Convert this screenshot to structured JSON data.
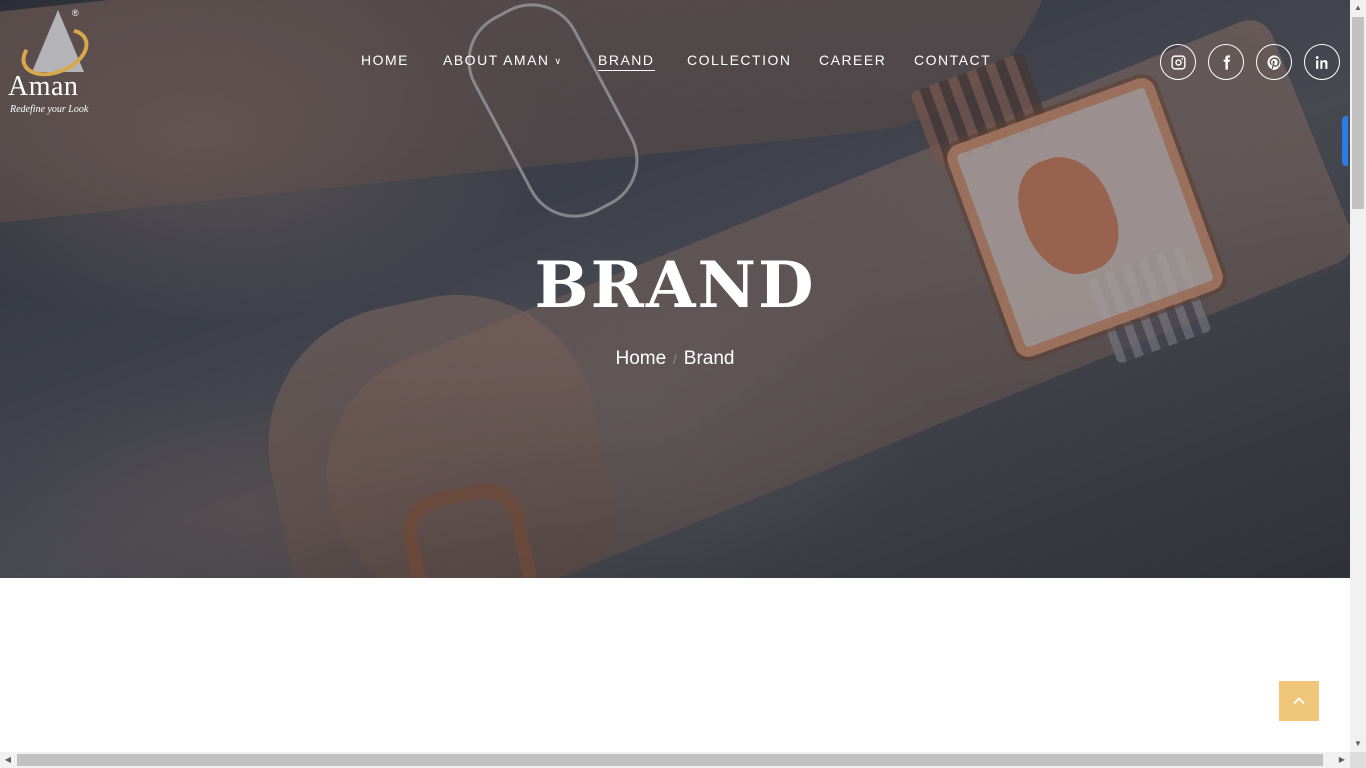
{
  "logo": {
    "name": "Aman",
    "tagline": "Redefine your Look",
    "reg_mark": "®"
  },
  "nav": {
    "items": [
      {
        "label": "HOME"
      },
      {
        "label": "ABOUT AMAN"
      },
      {
        "label": "BRAND",
        "active": true
      },
      {
        "label": "COLLECTION"
      },
      {
        "label": "CAREER"
      },
      {
        "label": "CONTACT"
      }
    ]
  },
  "social": [
    {
      "icon": "instagram-icon"
    },
    {
      "icon": "facebook-icon"
    },
    {
      "icon": "pinterest-icon"
    },
    {
      "icon": "linkedin-icon"
    }
  ],
  "hero": {
    "title": "BRAND",
    "breadcrumb": {
      "home": "Home",
      "separator": "/",
      "current": "Brand"
    }
  },
  "colors": {
    "accent": "#efc67a",
    "logo_ring": "#d8a84a",
    "text": "#ffffff"
  }
}
